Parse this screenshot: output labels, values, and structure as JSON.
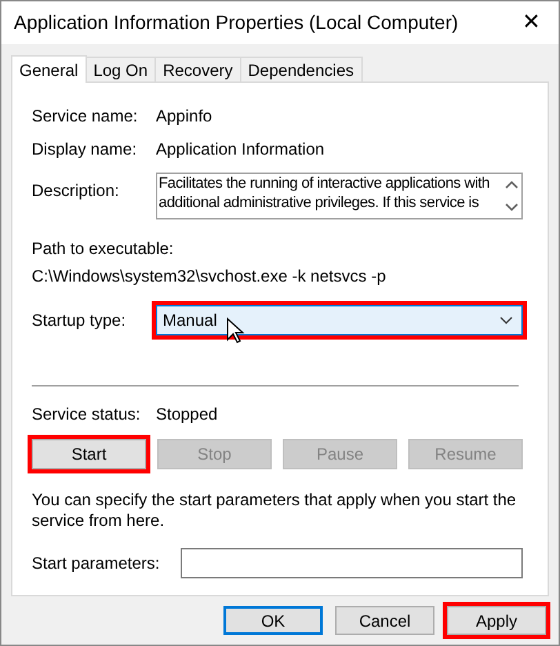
{
  "window": {
    "title": "Application Information Properties (Local Computer)",
    "close": "✕"
  },
  "tabs": [
    {
      "label": "General",
      "selected": true
    },
    {
      "label": "Log On",
      "selected": false
    },
    {
      "label": "Recovery",
      "selected": false
    },
    {
      "label": "Dependencies",
      "selected": false
    }
  ],
  "fields": [
    {
      "label": "Service name:",
      "value": "Appinfo"
    },
    {
      "label": "Display name:",
      "value": "Application Information"
    }
  ],
  "description": {
    "label": "Description:",
    "value": "Facilitates the running of interactive applications with additional administrative privileges.  If this service is"
  },
  "path": {
    "label": "Path to executable:",
    "value": "C:\\Windows\\system32\\svchost.exe -k netsvcs -p"
  },
  "startup": {
    "label": "Startup type:",
    "value": "Manual",
    "highlighted": true
  },
  "status": {
    "label": "Service status:",
    "value": "Stopped"
  },
  "service_buttons": [
    {
      "label": "Start",
      "disabled": false,
      "highlighted": true
    },
    {
      "label": "Stop",
      "disabled": true,
      "highlighted": false
    },
    {
      "label": "Pause",
      "disabled": true,
      "highlighted": false
    },
    {
      "label": "Resume",
      "disabled": true,
      "highlighted": false
    }
  ],
  "hint": "You can specify the start parameters that apply when you start the service from here.",
  "start_parameters": {
    "label": "Start parameters:"
  },
  "dialog_buttons": [
    {
      "label": "OK",
      "default": true,
      "highlighted": false
    },
    {
      "label": "Cancel",
      "default": false,
      "highlighted": false
    },
    {
      "label": "Apply",
      "default": false,
      "highlighted": true
    }
  ]
}
